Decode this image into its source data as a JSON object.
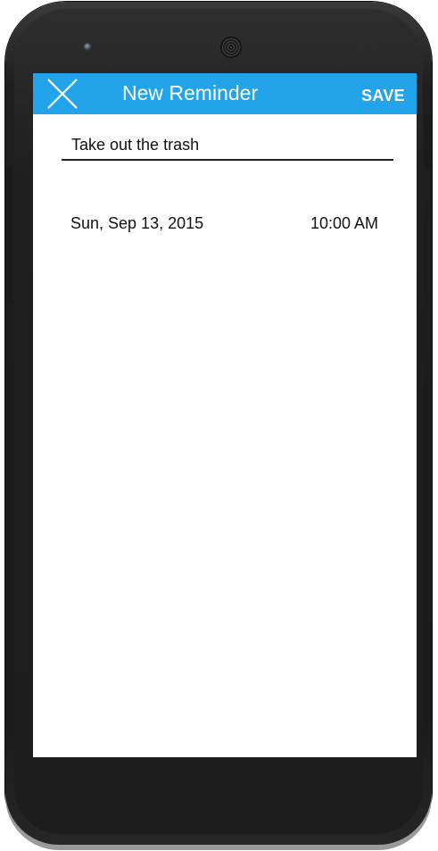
{
  "appbar": {
    "close_icon": "close-x-icon",
    "title": "New Reminder",
    "save_label": "SAVE",
    "color": "#22a3ea"
  },
  "reminder": {
    "text_value": "Take out the trash",
    "date": "Sun, Sep 13, 2015",
    "time": "10:00 AM"
  },
  "device": {
    "frame_color": "#1b1b1b"
  }
}
